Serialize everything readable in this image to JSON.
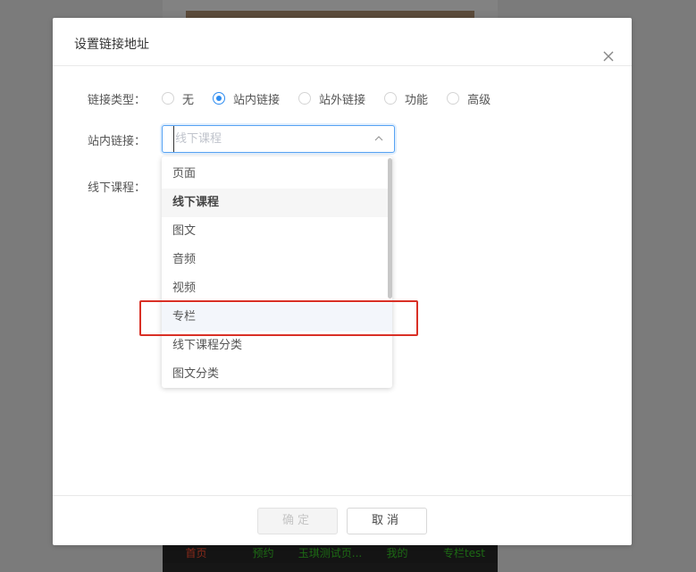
{
  "background": {
    "tabbar": {
      "items": [
        "首页",
        "预约",
        "玉琪测试页...",
        "我的",
        "专栏test"
      ],
      "active_index": 0,
      "active_color": "#8a2a1a",
      "item_color": "#1d6a14"
    }
  },
  "modal": {
    "title": "设置链接地址",
    "close_icon": "close-x-icon",
    "link_type": {
      "label": "链接类型：",
      "options": [
        "无",
        "站内链接",
        "站外链接",
        "功能",
        "高级"
      ],
      "selected": "站内链接"
    },
    "internal_link": {
      "label": "站内链接：",
      "placeholder": "线下课程",
      "arrow_icon": "chevron-up-icon"
    },
    "offline_course": {
      "label": "线下课程："
    },
    "dropdown": {
      "items": [
        "页面",
        "线下课程",
        "图文",
        "音频",
        "视频",
        "专栏",
        "线下课程分类",
        "图文分类"
      ],
      "selected": "线下课程",
      "hovered": "专栏"
    },
    "footer": {
      "confirm_label": "确定",
      "cancel_label": "取消"
    }
  },
  "colors": {
    "accent": "#2d8cf0",
    "highlight": "#d93026",
    "overlay": "#7b7b7b"
  }
}
